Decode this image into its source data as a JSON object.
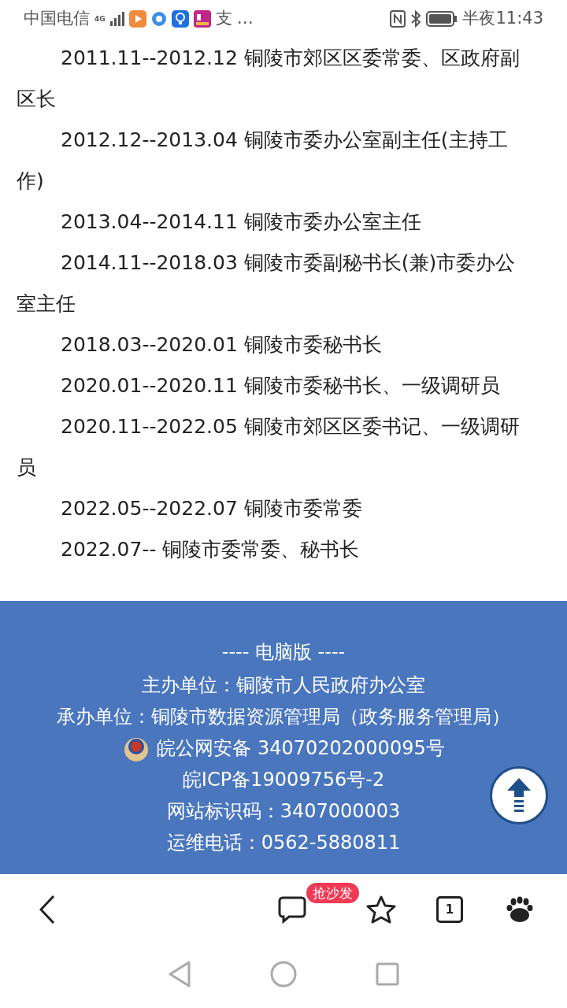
{
  "status_bar": {
    "carrier": "中国电信",
    "network": "4G",
    "app_glyph": "支",
    "more": "…",
    "time": "半夜11:43"
  },
  "article": {
    "paragraphs": [
      "2011.11--2012.12 铜陵市郊区区委常委、区政府副区长",
      "2012.12--2013.04 铜陵市委办公室副主任(主持工作)",
      "2013.04--2014.11 铜陵市委办公室主任",
      "2014.11--2018.03 铜陵市委副秘书长(兼)市委办公室主任",
      "2018.03--2020.01 铜陵市委秘书长",
      "2020.01--2020.11 铜陵市委秘书长、一级调研员",
      "2020.11--2022.05 铜陵市郊区区委书记、一级调研员",
      "2022.05--2022.07 铜陵市委常委",
      "2022.07-- 铜陵市委常委、秘书长"
    ]
  },
  "footer": {
    "desktop_link": "---- 电脑版 ----",
    "lines": [
      {
        "kind": "text",
        "text": "主办单位：铜陵市人民政府办公室"
      },
      {
        "kind": "text",
        "text": "承办单位：铜陵市数据资源管理局（政务服务管理局）"
      },
      {
        "kind": "badge",
        "text": "皖公网安备 34070202000095号"
      },
      {
        "kind": "text",
        "text": "皖ICP备19009756号-2"
      },
      {
        "kind": "text",
        "text": "网站标识码：3407000003"
      },
      {
        "kind": "text",
        "text": "运维电话：0562-5880811"
      }
    ]
  },
  "toolbar": {
    "comment_badge": "抢沙发",
    "tab_count": "1"
  }
}
